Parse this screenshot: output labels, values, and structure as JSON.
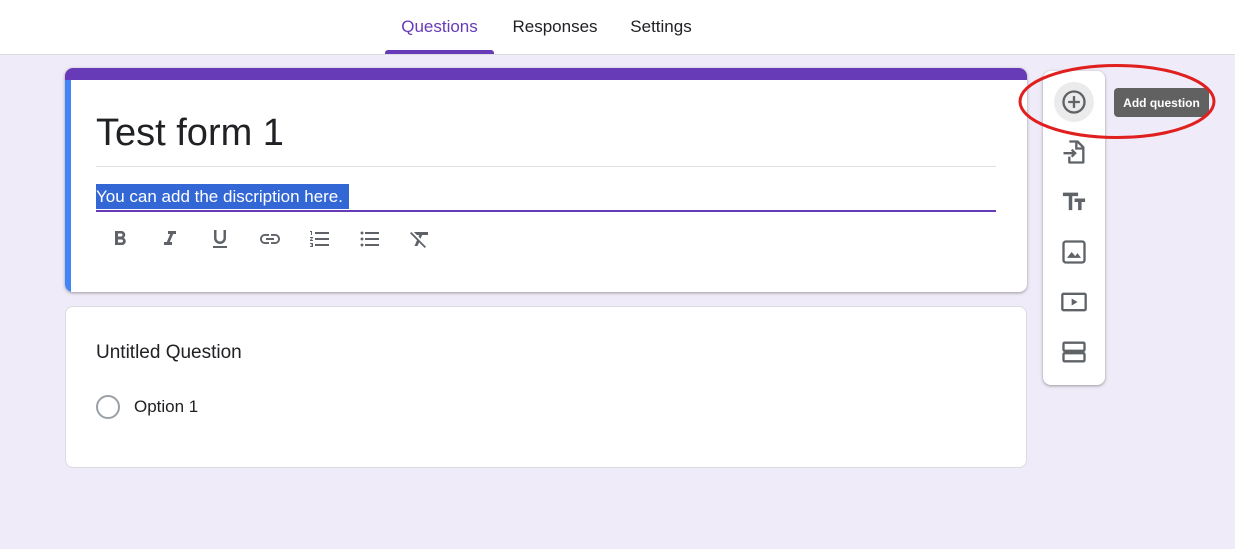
{
  "tabs": [
    {
      "label": "Questions",
      "active": true
    },
    {
      "label": "Responses",
      "active": false
    },
    {
      "label": "Settings",
      "active": false
    }
  ],
  "form": {
    "title": "Test form 1",
    "description": "You can add the discription here."
  },
  "format_toolbar": [
    "bold-icon",
    "italic-icon",
    "underline-icon",
    "link-icon",
    "numbered-list-icon",
    "bulleted-list-icon",
    "clear-formatting-icon"
  ],
  "question": {
    "title": "Untitled Question",
    "options": [
      "Option 1"
    ]
  },
  "side_toolbar": [
    "add-question-icon",
    "import-questions-icon",
    "add-title-icon",
    "add-image-icon",
    "add-video-icon",
    "add-section-icon"
  ],
  "tooltip": "Add question",
  "colors": {
    "accent": "#673ab7",
    "background": "#f0ebf8",
    "selection": "#3367d6",
    "annotation": "#e0201f"
  }
}
